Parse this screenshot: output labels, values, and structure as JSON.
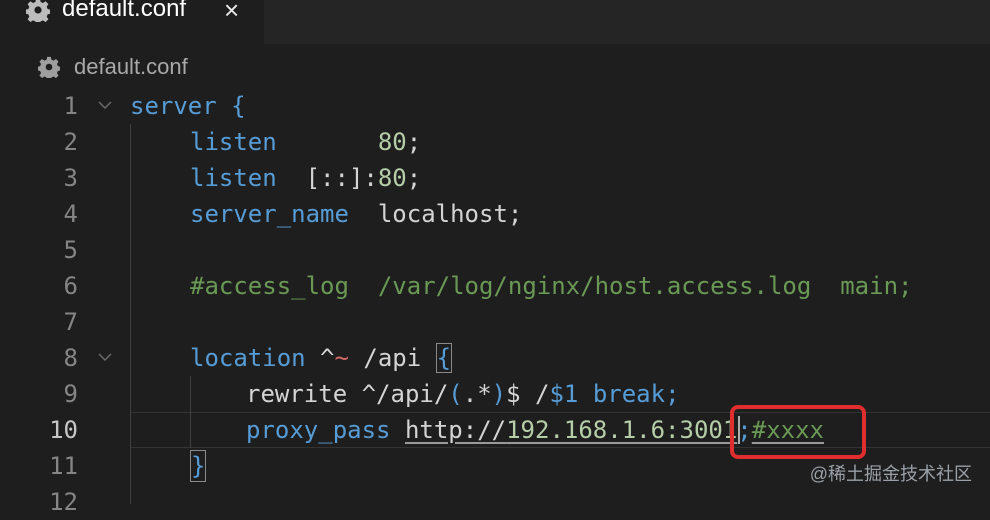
{
  "tab": {
    "title": "default.conf",
    "close_glyph": "×"
  },
  "breadcrumb": {
    "file": "default.conf"
  },
  "editor": {
    "line_numbers": [
      "1",
      "2",
      "3",
      "4",
      "5",
      "6",
      "7",
      "8",
      "9",
      "10",
      "11",
      "12"
    ],
    "active_line": "10",
    "lines": {
      "l1": {
        "kw": "server",
        "rest": " {"
      },
      "l2": {
        "kw": "listen",
        "gap": "       ",
        "val": "80",
        "end": ";"
      },
      "l3": {
        "kw": "listen",
        "mid": "  [::]:",
        "val": "80",
        "end": ";"
      },
      "l4": {
        "kw": "server_name",
        "rest": "  localhost;"
      },
      "l6": {
        "comment": "#access_log  /var/log/nginx/host.access.log  main;"
      },
      "l8": {
        "kw": "location",
        "mid": " ^",
        "tilde": "~",
        "path": " /api ",
        "brace": "{"
      },
      "l9": {
        "text1": "rewrite ^/api/",
        "rx1": "(",
        "text2": ".*",
        "rx2": ")",
        "text3": "$ /",
        "ref": "$1",
        "kw": " break",
        "end": ";"
      },
      "l10": {
        "kw": "proxy_pass",
        "sp": " ",
        "link1": "http://",
        "link2": "192.168.1.6:3001",
        "end": ";",
        "comment": "#xxxx"
      },
      "l11": {
        "brace": "}"
      }
    }
  },
  "watermark": "@稀土掘金技术社区",
  "colors": {
    "keyword": "#569cd6",
    "number": "#b5cea8",
    "comment": "#6a9955",
    "highlight_box": "#e02d2d"
  }
}
